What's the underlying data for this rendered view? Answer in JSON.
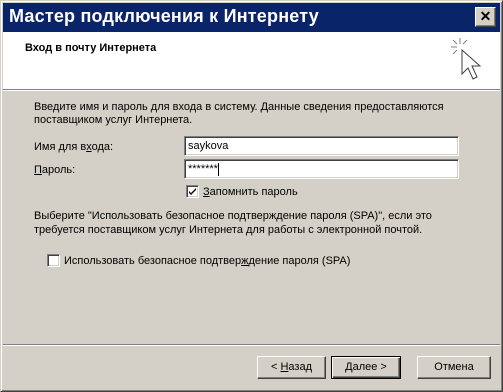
{
  "window": {
    "title": "Мастер подключения к Интернету",
    "close_label": "✕"
  },
  "header": {
    "title": "Вход в почту Интернета",
    "icon": "wizard-sparkle-cursor-icon"
  },
  "intro": {
    "line1": "Введите имя и пароль для входа в систему. Данные сведения предоставляются",
    "line2": "поставщиком услуг Интернета."
  },
  "form": {
    "username_label_pre": "Имя для в",
    "username_label_key": "х",
    "username_label_post": "ода:",
    "username_value": "saykova",
    "password_label_key": "П",
    "password_label_post": "ароль:",
    "password_value": "*******",
    "remember_key": "З",
    "remember_post": "апомнить пароль",
    "remember_checked": true
  },
  "spa_info": {
    "line1": "Выберите \"Использовать безопасное подтверждение пароля (SPA)\", если это",
    "line2": "требуется поставщиком услуг Интернета для работы с электронной почтой."
  },
  "spa_checkbox": {
    "label_pre": "Использовать безопасное подтвер",
    "label_key": "ж",
    "label_post": "дение пароля (SPA)",
    "checked": false
  },
  "buttons": {
    "back_prefix": "< ",
    "back_key": "Н",
    "back_post": "азад",
    "next_pre": "Далее ",
    "next_suffix": ">",
    "cancel": "Отмена"
  }
}
